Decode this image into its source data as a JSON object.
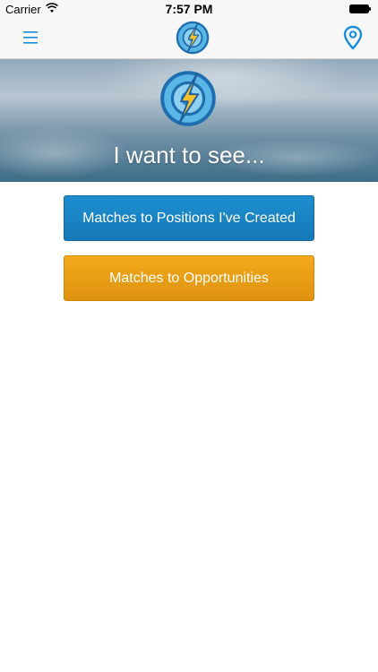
{
  "status_bar": {
    "carrier": "Carrier",
    "time": "7:57 PM"
  },
  "nav_bar": {
    "menu_icon": "hamburger-menu-icon",
    "logo_icon": "compass-lightning-logo-icon",
    "location_icon": "location-pin-icon",
    "accent_color": "#1a8fdc"
  },
  "hero": {
    "title": "I want to see..."
  },
  "actions": {
    "positions_label": "Matches to Positions I've Created",
    "opportunities_label": "Matches to Opportunities",
    "positions_color": "#1683c4",
    "opportunities_color": "#ea9e15"
  }
}
